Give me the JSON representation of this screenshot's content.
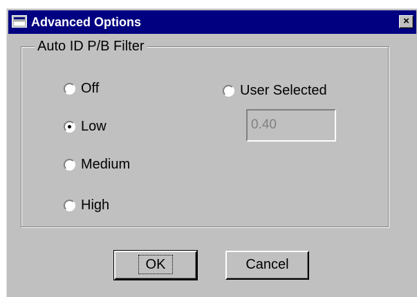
{
  "dialog": {
    "title": "Advanced Options",
    "close_glyph": "×"
  },
  "group": {
    "label": "Auto ID P/B Filter",
    "options": [
      {
        "label": "Off",
        "checked": false
      },
      {
        "label": "Low",
        "checked": true
      },
      {
        "label": "Medium",
        "checked": false
      },
      {
        "label": "High",
        "checked": false
      },
      {
        "label": "User Selected",
        "checked": false
      }
    ],
    "user_value": "0.40"
  },
  "buttons": {
    "ok_label": "OK",
    "cancel_label": "Cancel"
  },
  "colors": {
    "face": "#c0c0c0",
    "titlebar": "#000080",
    "disabled_text": "#808080"
  },
  "icons": {
    "window": "window-icon",
    "close": "close-icon"
  }
}
